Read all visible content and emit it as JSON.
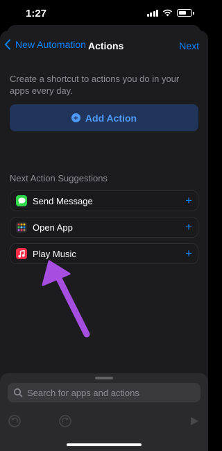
{
  "status": {
    "time": "1:27"
  },
  "nav": {
    "back_label": "New Automation",
    "title": "Actions",
    "next_label": "Next"
  },
  "description": "Create a shortcut to actions you do in your apps every day.",
  "add_action": {
    "label": "Add Action",
    "icon": "plus-circle-icon"
  },
  "suggestions": {
    "header": "Next Action Suggestions",
    "items": [
      {
        "label": "Send Message",
        "icon": "messages-app-icon",
        "color": "#32d74b"
      },
      {
        "label": "Open App",
        "icon": "open-app-grid-icon",
        "color": "#2c2c2e"
      },
      {
        "label": "Play Music",
        "icon": "music-app-icon",
        "color": "#fa2d48"
      }
    ]
  },
  "search": {
    "placeholder": "Search for apps and actions"
  },
  "colors": {
    "accent": "#0a84ff",
    "sheet": "#1c1c1e",
    "annotation_arrow": "#a64ee0"
  }
}
